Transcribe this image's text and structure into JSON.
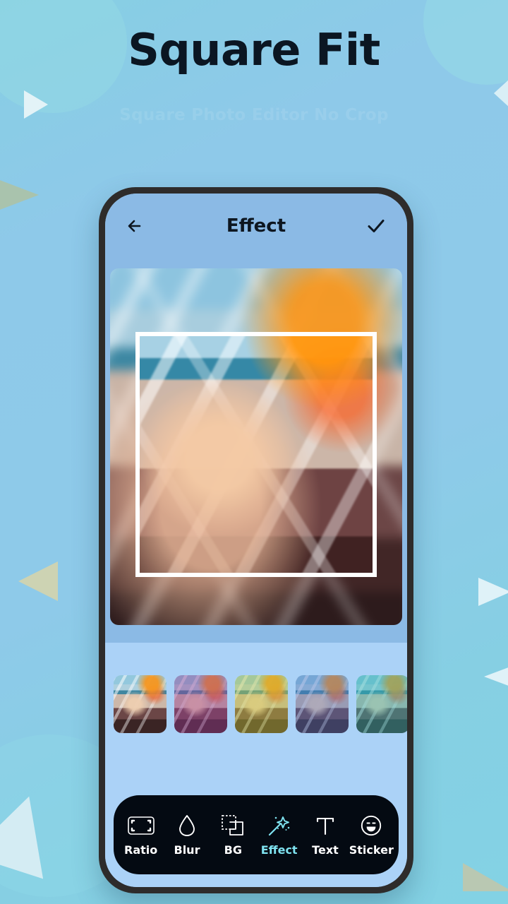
{
  "page": {
    "title": "Square Fit",
    "subtitle": "Square Photo Editor No Crop",
    "background_color": "#8ecae9",
    "accent_color": "#7fe3f0"
  },
  "app": {
    "header": {
      "back_icon": "arrow-left-icon",
      "title": "Effect",
      "done_icon": "check-icon"
    },
    "editor": {
      "canvas_label": "photo-canvas",
      "crop_frame_label": "square-crop-frame",
      "background_color": "#8bbae5",
      "panel_color": "#abd2f7"
    },
    "filters": [
      {
        "name": "Original",
        "tint": "rgba(0,0,0,0)"
      },
      {
        "name": "Purple",
        "tint": "rgba(150,60,150,0.42)"
      },
      {
        "name": "Lime",
        "tint": "rgba(190,200,60,0.42)"
      },
      {
        "name": "Azure",
        "tint": "rgba(70,110,200,0.38)"
      },
      {
        "name": "Teal",
        "tint": "rgba(40,180,180,0.42)"
      }
    ],
    "toolbar": {
      "items": [
        {
          "label": "Ratio",
          "icon": "ratio-icon",
          "active": false
        },
        {
          "label": "Blur",
          "icon": "blur-icon",
          "active": false
        },
        {
          "label": "BG",
          "icon": "background-icon",
          "active": false
        },
        {
          "label": "Effect",
          "icon": "magic-wand-icon",
          "active": true
        },
        {
          "label": "Text",
          "icon": "text-icon",
          "active": false
        },
        {
          "label": "Sticker",
          "icon": "sticker-icon",
          "active": false
        }
      ],
      "background_color": "#040a12",
      "active_color": "#7fe3f0"
    }
  }
}
